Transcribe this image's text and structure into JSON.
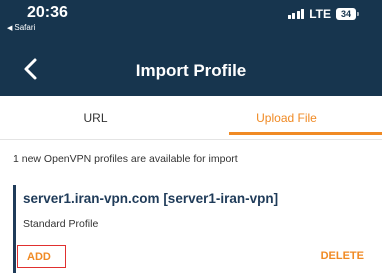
{
  "status_bar": {
    "time": "20:36",
    "back_app": "Safari",
    "network": "LTE",
    "battery": "34"
  },
  "nav": {
    "title": "Import Profile"
  },
  "tabs": [
    {
      "label": "URL",
      "active": false
    },
    {
      "label": "Upload File",
      "active": true
    }
  ],
  "info_text": "1 new OpenVPN profiles are available for import",
  "profile": {
    "title": "server1.iran-vpn.com [server1-iran-vpn]",
    "subtitle": "Standard Profile",
    "add_label": "ADD",
    "delete_label": "DELETE"
  },
  "colors": {
    "header_bg": "#17354e",
    "accent": "#f08a24",
    "highlight_border": "#e0302f"
  }
}
